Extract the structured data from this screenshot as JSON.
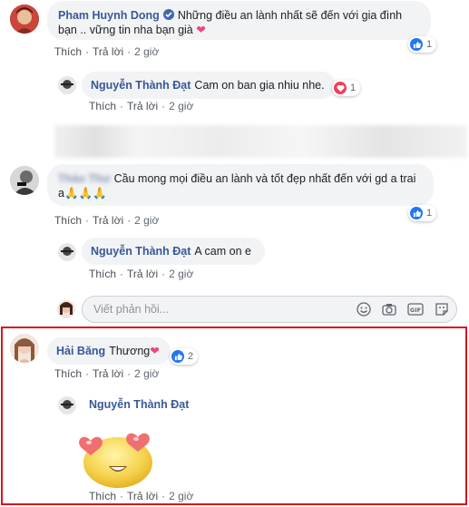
{
  "comments": [
    {
      "author": "Pham Huynh Dong",
      "verified": true,
      "text_line1": "Những điều an lành nhất sẽ đến với gia đình",
      "text_line2": "bạn .. vững tin nha bạn già",
      "reaction_count": "1",
      "actions": {
        "like": "Thích",
        "reply": "Trả lời",
        "time": "2 giờ"
      },
      "reply": {
        "author": "Nguyễn Thành Đạt",
        "text": "Cam on ban gia nhiu nhe.",
        "reaction_count": "1",
        "actions": {
          "like": "Thích",
          "reply": "Trả lời",
          "time": "2 giờ"
        }
      }
    },
    {
      "author": "Thảo Thư",
      "text_line1": "Cầu mong mọi điều an lành và tốt đẹp nhất đến với gd a trai",
      "text_line2": "a🙏🙏🙏",
      "reaction_count": "1",
      "actions": {
        "like": "Thích",
        "reply": "Trả lời",
        "time": "2 giờ"
      },
      "reply": {
        "author": "Nguyễn Thành Đạt",
        "text": "A cam on e",
        "actions": {
          "like": "Thích",
          "reply": "Trả lời",
          "time": "2 giờ"
        }
      }
    },
    {
      "author": "Hải Băng",
      "text": "Thương",
      "reaction_count": "2",
      "actions": {
        "like": "Thích",
        "reply": "Trả lời",
        "time": "2 giờ"
      },
      "reply": {
        "author": "Nguyễn Thành Đạt",
        "sticker": "heart-eyes-emoji",
        "actions": {
          "like": "Thích",
          "reply": "Trả lời",
          "time": "2 giờ"
        }
      }
    }
  ],
  "reply_input": {
    "placeholder": "Viết phản hồi..."
  },
  "icons": [
    "like-icon",
    "heart-icon",
    "emoji-icon",
    "camera-icon",
    "gif-icon",
    "sticker-icon",
    "verified-badge-icon"
  ],
  "colors": {
    "author": "#385898",
    "bubble": "#f2f3f5",
    "like": "#2078f4",
    "love": "#f33e58",
    "highlight": "#d8151c"
  }
}
